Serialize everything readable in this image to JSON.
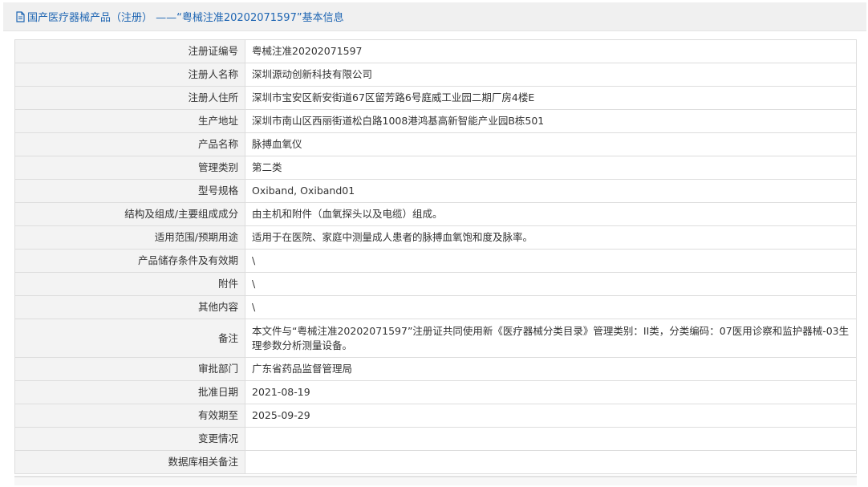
{
  "header": {
    "title": "国产医疗器械产品（注册） ——“粤械注准20202071597”基本信息",
    "icon": "document-icon"
  },
  "rows": [
    {
      "label": "注册证编号",
      "value": "粤械注准20202071597"
    },
    {
      "label": "注册人名称",
      "value": "深圳源动创新科技有限公司"
    },
    {
      "label": "注册人住所",
      "value": "深圳市宝安区新安街道67区留芳路6号庭威工业园二期厂房4楼E"
    },
    {
      "label": "生产地址",
      "value": "深圳市南山区西丽街道松白路1008港鸿基高新智能产业园B栋501"
    },
    {
      "label": "产品名称",
      "value": "脉搏血氧仪"
    },
    {
      "label": "管理类别",
      "value": "第二类"
    },
    {
      "label": "型号规格",
      "value": "Oxiband, Oxiband01"
    },
    {
      "label": "结构及组成/主要组成成分",
      "value": "由主机和附件（血氧探头以及电缆）组成。"
    },
    {
      "label": "适用范围/预期用途",
      "value": "适用于在医院、家庭中测量成人患者的脉搏血氧饱和度及脉率。"
    },
    {
      "label": "产品储存条件及有效期",
      "value": "\\"
    },
    {
      "label": "附件",
      "value": "\\"
    },
    {
      "label": "其他内容",
      "value": "\\"
    },
    {
      "label": "备注",
      "value": "本文件与“粤械注准20202071597”注册证共同使用新《医疗器械分类目录》管理类别：II类，分类编码：07医用诊察和监护器械-03生理参数分析测量设备。"
    },
    {
      "label": "审批部门",
      "value": "广东省药品监督管理局"
    },
    {
      "label": "批准日期",
      "value": "2021-08-19"
    },
    {
      "label": "有效期至",
      "value": "2025-09-29"
    },
    {
      "label": "变更情况",
      "value": ""
    },
    {
      "label": "数据库相关备注",
      "value": ""
    }
  ],
  "colors": {
    "title_text": "#1f66b3",
    "title_bar_bg": "#f0f0f0",
    "label_bg": "#f3f3f3",
    "border": "#dddddd"
  }
}
